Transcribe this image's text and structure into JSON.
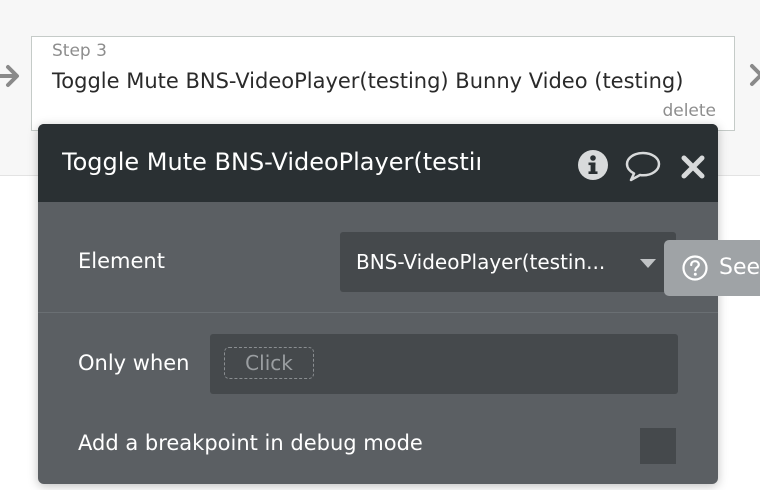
{
  "step": {
    "label": "Step 3",
    "title": "Toggle Mute BNS-VideoPlayer(testing) Bunny Video (testing)",
    "delete_label": "delete"
  },
  "panel": {
    "title": "Toggle Mute BNS-VideoPlayer(testing) Bunny Video (testing)",
    "element_label": "Element",
    "element_value": "BNS-VideoPlayer(testin...",
    "only_when_label": "Only when",
    "condition_placeholder": "Click",
    "breakpoint_label": "Add a breakpoint in debug mode",
    "breakpoint_checked": false
  },
  "help_button": {
    "label": "See"
  },
  "icons": [
    "arrow-left-icon",
    "arrow-right-icon",
    "info-icon",
    "comment-icon",
    "close-icon",
    "caret-down-icon",
    "help-circle-icon"
  ],
  "colors": {
    "header_bg": "#2a3033",
    "panel_bg": "#5b5f63",
    "field_bg": "#45494c",
    "help_bg": "#9fa3a6"
  }
}
